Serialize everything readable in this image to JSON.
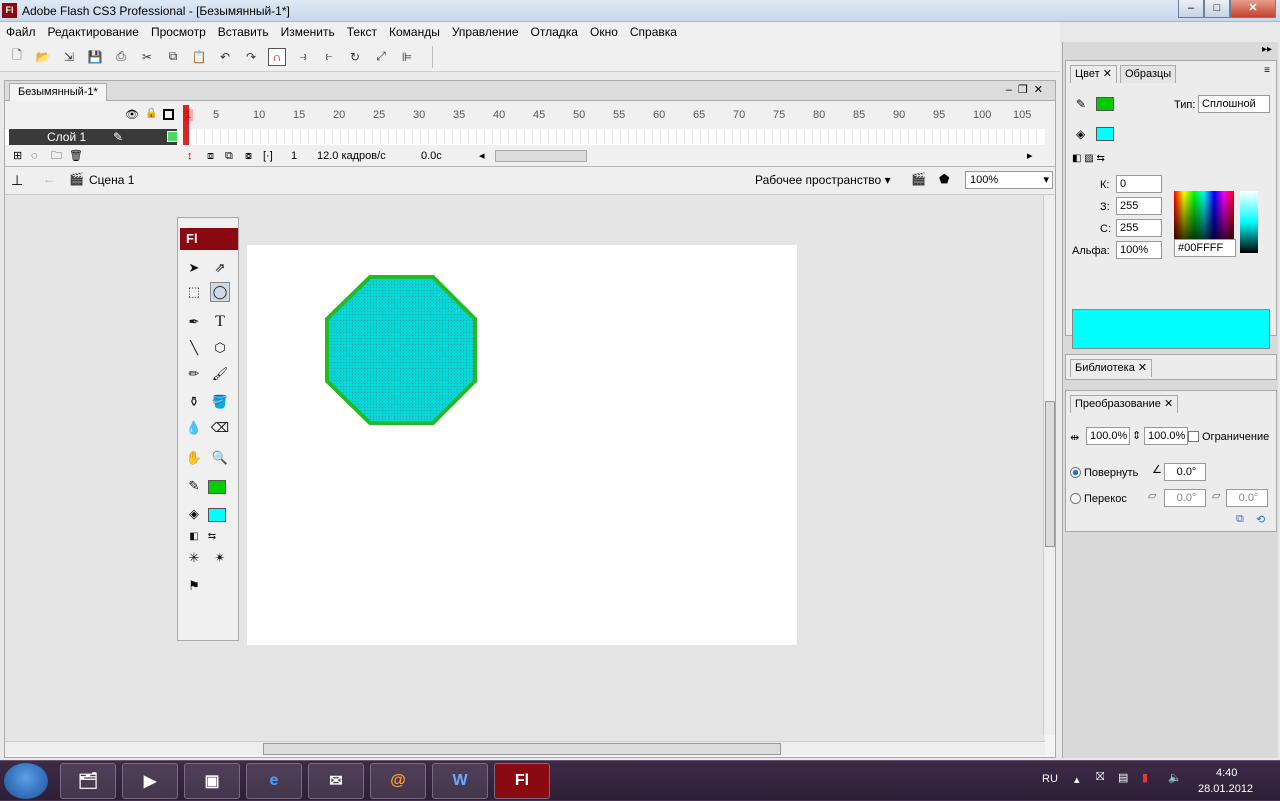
{
  "window": {
    "title": "Adobe Flash CS3 Professional - [Безымянный-1*]",
    "logo": "Fl",
    "min": "–",
    "max": "□",
    "close": "✕"
  },
  "menu": [
    "Файл",
    "Редактирование",
    "Просмотр",
    "Вставить",
    "Изменить",
    "Текст",
    "Команды",
    "Управление",
    "Отладка",
    "Окно",
    "Справка"
  ],
  "document": {
    "tab": "Безымянный-1*",
    "ruler_ticks": [
      "1",
      "5",
      "10",
      "15",
      "20",
      "25",
      "30",
      "35",
      "40",
      "45",
      "50",
      "55",
      "60",
      "65",
      "70",
      "75",
      "80",
      "85",
      "90",
      "95",
      "100",
      "105"
    ],
    "layer_name": "Слой 1",
    "current_frame": "1",
    "frame_rate": "12.0 кадров/с",
    "elapsed": "0.0с",
    "scene": "Сцена 1",
    "workspace": "Рабочее пространство",
    "zoom": "100%"
  },
  "tools": {
    "brand": "Fl",
    "stroke_color": "#00cc00",
    "fill_color": "#00ffff"
  },
  "color_panel": {
    "tabs": [
      "Цвет",
      "Образцы"
    ],
    "type_label": "Тип:",
    "type_value": "Сплошной",
    "r_label": "К:",
    "r_value": "0",
    "g_label": "З:",
    "g_value": "255",
    "b_label": "С:",
    "b_value": "255",
    "alpha_label": "Альфа:",
    "alpha_value": "100%",
    "hex": "#00FFFF",
    "stroke_color": "#00cc00",
    "fill_color": "#00ffff"
  },
  "library_panel": {
    "tab": "Библиотека"
  },
  "transform_panel": {
    "tab": "Преобразование",
    "width": "100.0%",
    "height": "100.0%",
    "constrain": "Ограничение",
    "rotate_label": "Повернуть",
    "rotate_value": "0.0°",
    "skew_label": "Перекос",
    "skew_h": "0.0°",
    "skew_v": "0.0°"
  },
  "shape": {
    "fill": "#00cccc",
    "stroke": "#22bb22"
  },
  "taskbar": {
    "lang": "RU",
    "time": "4:40",
    "date": "28.01.2012",
    "flash_label": "Fl"
  }
}
